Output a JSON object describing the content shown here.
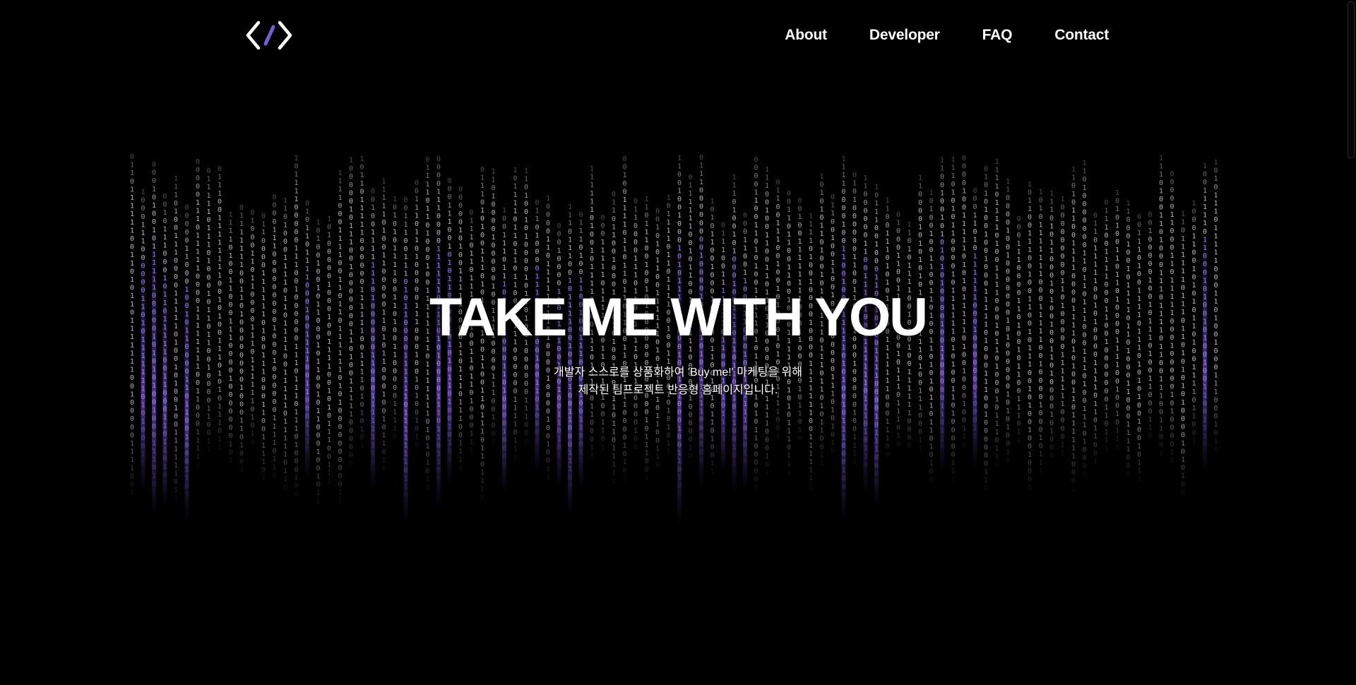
{
  "header": {
    "logo_name": "code-brackets-logo",
    "nav": [
      {
        "label": "About"
      },
      {
        "label": "Developer"
      },
      {
        "label": "FAQ"
      },
      {
        "label": "Contact"
      }
    ]
  },
  "hero": {
    "title": "TAKE ME WITH YOU",
    "subtitle_line1": "개발자 스스로를 상품화하여 'Buy me!' 마케팅을 위해",
    "subtitle_line2": "제작된 팀프로젝트 반응형 홈페이지입니다."
  },
  "colors": {
    "background": "#000000",
    "text": "#ffffff",
    "accent": "#8a5cf6",
    "logo_slash": "#7c5cd6"
  }
}
